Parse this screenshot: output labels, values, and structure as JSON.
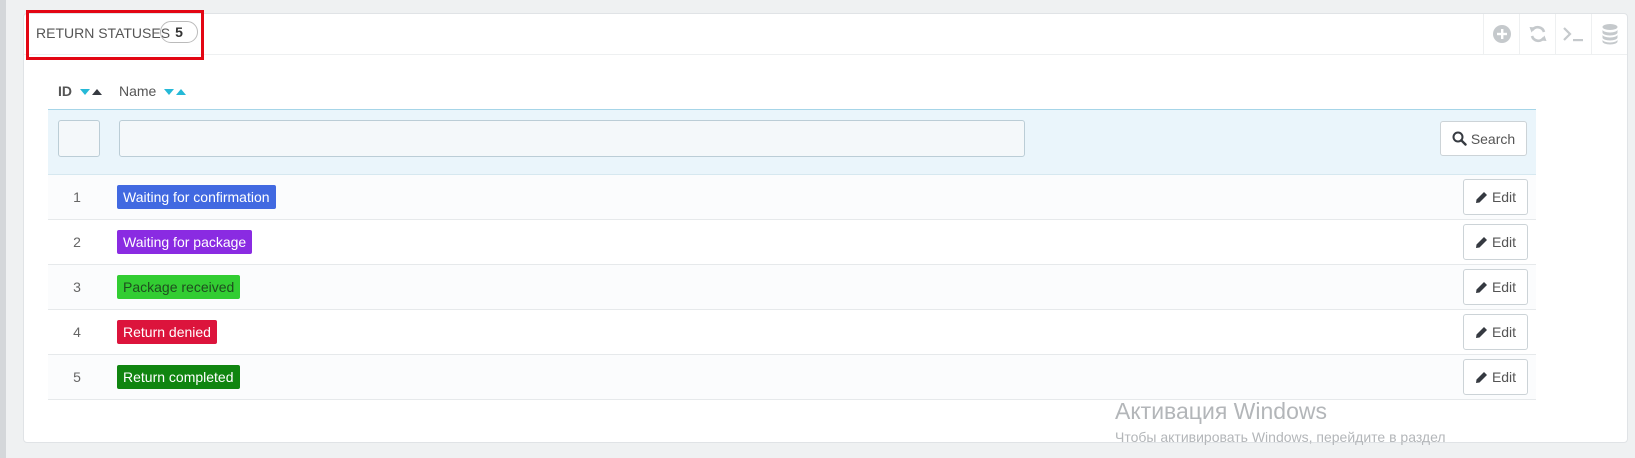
{
  "panel": {
    "title": "RETURN STATUSES",
    "count": "5",
    "toolbar": [
      {
        "name": "add-icon"
      },
      {
        "name": "refresh-icon"
      },
      {
        "name": "sql-query-icon"
      },
      {
        "name": "database-icon"
      }
    ]
  },
  "table": {
    "columns": {
      "id": "ID",
      "name": "Name"
    },
    "search_label": "Search",
    "edit_label": "Edit",
    "rows": [
      {
        "id": "1",
        "name": "Waiting for confirmation",
        "color": "#4169e1"
      },
      {
        "id": "2",
        "name": "Waiting for package",
        "color": "#8a2be2"
      },
      {
        "id": "3",
        "name": "Package received",
        "color": "#32cd32"
      },
      {
        "id": "4",
        "name": "Return denied",
        "color": "#dc143c"
      },
      {
        "id": "5",
        "name": "Return completed",
        "color": "#108510"
      }
    ]
  },
  "watermark": {
    "title": "Активация Windows",
    "subtitle": "Чтобы активировать Windows, перейдите в раздел"
  }
}
